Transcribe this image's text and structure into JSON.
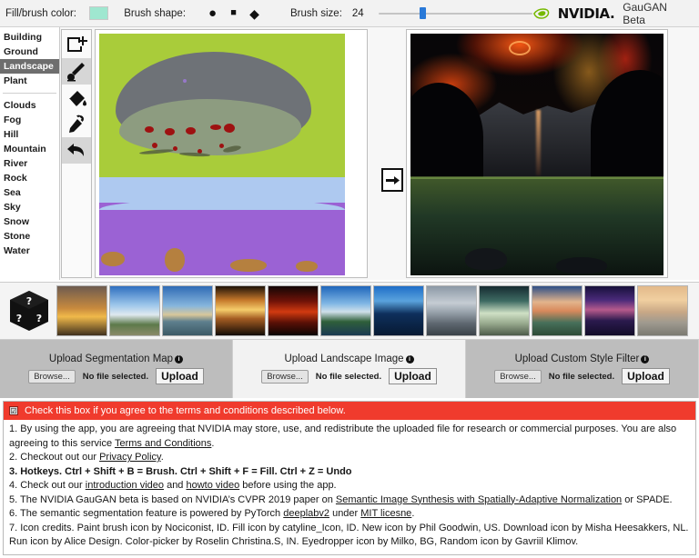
{
  "toolbar": {
    "fill_color_label": "Fill/brush color:",
    "fill_color_hex": "#9fe7d0",
    "brush_shape_label": "Brush shape:",
    "shape_circle": "●",
    "shape_square": "■",
    "shape_diamond": "◆",
    "brush_size_label": "Brush size:",
    "brush_size_value": "24",
    "brand_word": "NVIDIA.",
    "app_title": "GauGAN Beta"
  },
  "segmentation_classes": {
    "group_one": [
      "Building",
      "Ground",
      "Landscape",
      "Plant"
    ],
    "selected": "Landscape",
    "group_two": [
      "Clouds",
      "Fog",
      "Hill",
      "Mountain",
      "River",
      "Rock",
      "Sea",
      "Sky",
      "Snow",
      "Stone",
      "Water"
    ]
  },
  "tools": [
    {
      "name": "new-icon",
      "label": "New"
    },
    {
      "name": "paintbrush-icon",
      "label": "Brush",
      "active": true
    },
    {
      "name": "fill-bucket-icon",
      "label": "Fill"
    },
    {
      "name": "eyedropper-icon",
      "label": "Eyedropper"
    },
    {
      "name": "undo-icon",
      "label": "Undo",
      "active": true
    }
  ],
  "canvas": {
    "run_icon": "→",
    "download_seg_icon": "download-icon",
    "download_out_icon": "download-icon"
  },
  "style_filters": {
    "random_label": "Random style",
    "thumb_count": 12
  },
  "uploads": [
    {
      "title": "Upload Segmentation Map",
      "info": "i",
      "browse": "Browse...",
      "status": "No file selected.",
      "button": "Upload"
    },
    {
      "title": "Upload Landscape Image",
      "info": "i",
      "browse": "Browse...",
      "status": "No file selected.",
      "button": "Upload"
    },
    {
      "title": "Upload Custom Style Filter",
      "info": "i",
      "browse": "Browse...",
      "status": "No file selected.",
      "button": "Upload"
    }
  ],
  "terms": {
    "banner_color": "#f03b2d",
    "agree_label": "Check this box if you agree to the terms and conditions described below.",
    "checkbox_mark": "☑",
    "items": [
      {
        "id": 1,
        "bold": false,
        "parts": [
          {
            "t": "1. By using the app, you are agreeing that NVIDIA may store, use, and redistribute the uploaded file for research or commercial purposes. You are also agreeing to this service ",
            "link": false
          },
          {
            "t": "Terms and Conditions",
            "link": true
          },
          {
            "t": ".",
            "link": false
          }
        ]
      },
      {
        "id": 2,
        "bold": false,
        "parts": [
          {
            "t": "2. Checkout out our ",
            "link": false
          },
          {
            "t": "Privacy Policy",
            "link": true
          },
          {
            "t": ".",
            "link": false
          }
        ]
      },
      {
        "id": 3,
        "bold": true,
        "parts": [
          {
            "t": "3. Hotkeys. Ctrl + Shift + B = Brush. Ctrl + Shift + F = Fill. Ctrl + Z = Undo",
            "link": false
          }
        ]
      },
      {
        "id": 4,
        "bold": false,
        "parts": [
          {
            "t": "4. Check out our ",
            "link": false
          },
          {
            "t": "introduction video",
            "link": true
          },
          {
            "t": " and ",
            "link": false
          },
          {
            "t": "howto video",
            "link": true
          },
          {
            "t": " before using the app.",
            "link": false
          }
        ]
      },
      {
        "id": 5,
        "bold": false,
        "parts": [
          {
            "t": "5. The NVIDIA GauGAN beta is based on NVIDIA’s CVPR 2019 paper on ",
            "link": false
          },
          {
            "t": "Semantic Image Synthesis with Spatially-Adaptive Normalization",
            "link": true
          },
          {
            "t": " or SPADE.",
            "link": false
          }
        ]
      },
      {
        "id": 6,
        "bold": false,
        "parts": [
          {
            "t": "6. The semantic segmentation feature is powered by PyTorch ",
            "link": false
          },
          {
            "t": "deeplabv2",
            "link": true
          },
          {
            "t": " under ",
            "link": false
          },
          {
            "t": "MIT licesne",
            "link": true
          },
          {
            "t": ".",
            "link": false
          }
        ]
      },
      {
        "id": 7,
        "bold": false,
        "parts": [
          {
            "t": "7. Icon credits. Paint brush icon by Nociconist, ID. Fill icon by catyline_Icon, ID. New icon by Phil Goodwin, US. Download icon by Misha Heesakkers, NL. Run icon by Alice Design. Color-picker by Roselin Christina.S, IN. Eyedropper icon by Milko, BG, Random icon by Gavriil Klimov.",
            "link": false
          }
        ]
      }
    ]
  }
}
